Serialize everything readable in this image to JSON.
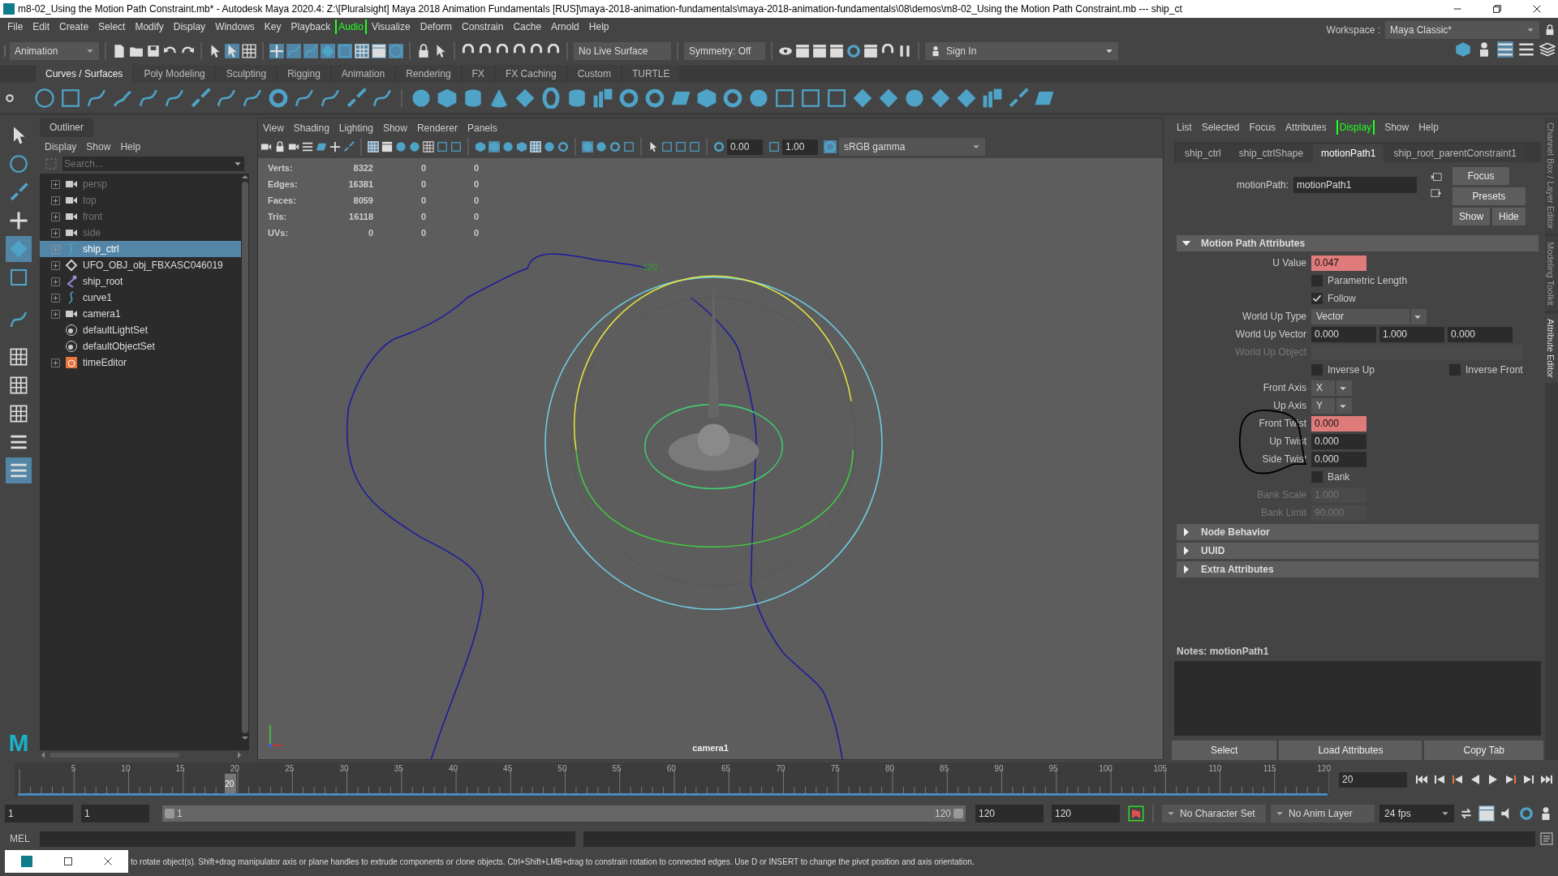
{
  "window": {
    "title": "m8-02_Using the Motion Path Constraint.mb* - Autodesk Maya 2020.4: Z:\\[Pluralsight] Maya 2018 Animation Fundamentals [RUS]\\maya-2018-animation-fundamentals\\maya-2018-animation-fundamentals\\08\\demos\\m8-02_Using the Motion Path Constraint.mb   ---   ship_ct"
  },
  "menu_bar": [
    {
      "label": "File",
      "bracketed": false
    },
    {
      "label": "Edit",
      "bracketed": false
    },
    {
      "label": "Create",
      "bracketed": false
    },
    {
      "label": "Select",
      "bracketed": false
    },
    {
      "label": "Modify",
      "bracketed": false
    },
    {
      "label": "Display",
      "bracketed": false
    },
    {
      "label": "Windows",
      "bracketed": false
    },
    {
      "label": "Key",
      "bracketed": false
    },
    {
      "label": "Playback",
      "bracketed": false
    },
    {
      "label": "Audio",
      "bracketed": true
    },
    {
      "label": "Visualize",
      "bracketed": false
    },
    {
      "label": "Deform",
      "bracketed": false
    },
    {
      "label": "Constrain",
      "bracketed": false
    },
    {
      "label": "Cache",
      "bracketed": false
    },
    {
      "label": "Arnold",
      "bracketed": false
    },
    {
      "label": "Help",
      "bracketed": false
    }
  ],
  "status_line": {
    "mode": "Animation",
    "live_surface": "No Live Surface",
    "symmetry": "Symmetry: Off",
    "sign_in": "Sign In",
    "workspace_label": "Workspace :",
    "workspace": "Maya Classic*"
  },
  "shelf_tabs": [
    {
      "label": "Curves / Surfaces",
      "selected": true
    },
    {
      "label": "Poly Modeling",
      "selected": false
    },
    {
      "label": "Sculpting",
      "selected": false
    },
    {
      "label": "Rigging",
      "selected": false
    },
    {
      "label": "Animation",
      "selected": false
    },
    {
      "label": "Rendering",
      "selected": false
    },
    {
      "label": "FX",
      "selected": false
    },
    {
      "label": "FX Caching",
      "selected": false
    },
    {
      "label": "Custom",
      "selected": false
    },
    {
      "label": "TURTLE",
      "selected": false
    }
  ],
  "toolbox": {
    "logo": "M"
  },
  "outliner": {
    "title": "Outliner",
    "menus": [
      "Display",
      "Show",
      "Help"
    ],
    "search_placeholder": "Search...",
    "items": [
      {
        "label": "persp",
        "kind": "camera",
        "expandable": true,
        "dimmed": true,
        "selected": false
      },
      {
        "label": "top",
        "kind": "camera",
        "expandable": true,
        "dimmed": true,
        "selected": false
      },
      {
        "label": "front",
        "kind": "camera",
        "expandable": true,
        "dimmed": true,
        "selected": false
      },
      {
        "label": "side",
        "kind": "camera",
        "expandable": true,
        "dimmed": true,
        "selected": false
      },
      {
        "label": "ship_ctrl",
        "kind": "curve",
        "expandable": true,
        "dimmed": false,
        "selected": true
      },
      {
        "label": "UFO_OBJ_obj_FBXASC046019",
        "kind": "mesh",
        "expandable": true,
        "dimmed": false,
        "selected": false
      },
      {
        "label": "ship_root",
        "kind": "joint",
        "expandable": true,
        "dimmed": false,
        "selected": false
      },
      {
        "label": "curve1",
        "kind": "curve",
        "expandable": true,
        "dimmed": false,
        "selected": false
      },
      {
        "label": "camera1",
        "kind": "camera",
        "expandable": true,
        "dimmed": false,
        "selected": false
      },
      {
        "label": "defaultLightSet",
        "kind": "set",
        "expandable": false,
        "dimmed": false,
        "selected": false
      },
      {
        "label": "defaultObjectSet",
        "kind": "set",
        "expandable": false,
        "dimmed": false,
        "selected": false
      },
      {
        "label": "timeEditor",
        "kind": "time",
        "expandable": true,
        "dimmed": false,
        "selected": false
      }
    ]
  },
  "viewport": {
    "menus": [
      "View",
      "Shading",
      "Lighting",
      "Show",
      "Renderer",
      "Panels"
    ],
    "exposure": "0.00",
    "gamma": "1.00",
    "color_space": "sRGB gamma",
    "stats": [
      {
        "label": "Verts:",
        "values": [
          "8322",
          "0",
          "0"
        ]
      },
      {
        "label": "Edges:",
        "values": [
          "16381",
          "0",
          "0"
        ]
      },
      {
        "label": "Faces:",
        "values": [
          "8059",
          "0",
          "0"
        ]
      },
      {
        "label": "Tris:",
        "values": [
          "16118",
          "0",
          "0"
        ]
      },
      {
        "label": "UVs:",
        "values": [
          "0",
          "0",
          "0"
        ]
      }
    ],
    "path_label": "120",
    "camera": "camera1"
  },
  "attribute_editor": {
    "menus": [
      {
        "label": "List",
        "bracketed": false
      },
      {
        "label": "Selected",
        "bracketed": false
      },
      {
        "label": "Focus",
        "bracketed": false
      },
      {
        "label": "Attributes",
        "bracketed": false
      },
      {
        "label": "Display",
        "bracketed": true
      },
      {
        "label": "Show",
        "bracketed": false
      },
      {
        "label": "Help",
        "bracketed": false
      }
    ],
    "tabs": [
      {
        "label": "ship_ctrl",
        "selected": false
      },
      {
        "label": "ship_ctrlShape",
        "selected": false
      },
      {
        "label": "motionPath1",
        "selected": true
      },
      {
        "label": "ship_root_parentConstraint1",
        "selected": false
      }
    ],
    "node_label": "motionPath:",
    "node_name": "motionPath1",
    "buttons": [
      "Focus",
      "Presets",
      "Show",
      "Hide"
    ],
    "sections": [
      {
        "title": "Motion Path Attributes",
        "expanded": true,
        "rows": [
          {
            "kind": "number",
            "label": "U Value",
            "values": [
              "0.047"
            ],
            "keyed": true,
            "disabled": false,
            "circled": false
          },
          {
            "kind": "checkbox",
            "label": "Parametric Length",
            "checked": false
          },
          {
            "kind": "checkbox",
            "label": "Follow",
            "checked": true
          },
          {
            "kind": "menu",
            "label": "World Up Type",
            "value": "Vector"
          },
          {
            "kind": "number",
            "label": "World Up Vector",
            "values": [
              "0.000",
              "1.000",
              "0.000"
            ],
            "keyed": false,
            "disabled": false,
            "circled": false
          },
          {
            "kind": "field",
            "label": "World Up Object",
            "disabled": true
          },
          {
            "kind": "checkbox_pair",
            "items": [
              {
                "label": "Inverse Up",
                "checked": false
              },
              {
                "label": "Inverse Front",
                "checked": false
              }
            ]
          },
          {
            "kind": "axis",
            "label": "Front Axis",
            "value": "X"
          },
          {
            "kind": "axis",
            "label": "Up Axis",
            "value": "Y"
          },
          {
            "kind": "number",
            "label": "Front Twist",
            "values": [
              "0.000"
            ],
            "keyed": true,
            "disabled": false,
            "circled": true
          },
          {
            "kind": "number",
            "label": "Up Twist",
            "values": [
              "0.000"
            ],
            "keyed": false,
            "disabled": false,
            "circled": true
          },
          {
            "kind": "number",
            "label": "Side Twist",
            "values": [
              "0.000"
            ],
            "keyed": false,
            "disabled": false,
            "circled": true
          },
          {
            "kind": "checkbox",
            "label": "Bank",
            "checked": false
          },
          {
            "kind": "number",
            "label": "Bank Scale",
            "values": [
              "1.000"
            ],
            "keyed": false,
            "disabled": true,
            "circled": false
          },
          {
            "kind": "number",
            "label": "Bank Limit",
            "values": [
              "90.000"
            ],
            "keyed": false,
            "disabled": true,
            "circled": false
          }
        ]
      },
      {
        "title": "Node Behavior",
        "expanded": false
      },
      {
        "title": "UUID",
        "expanded": false
      },
      {
        "title": "Extra Attributes",
        "expanded": false
      }
    ],
    "notes_label": "Notes:  motionPath1",
    "bottom_buttons": [
      "Select",
      "Load Attributes",
      "Copy Tab"
    ]
  },
  "side_tabs": [
    {
      "label": "Channel Box / Layer Editor",
      "selected": false
    },
    {
      "label": "Modeling Toolkit",
      "selected": false
    },
    {
      "label": "Attribute Editor",
      "selected": true
    }
  ],
  "time_slider": {
    "ticks": [
      "5",
      "10",
      "15",
      "20",
      "25",
      "30",
      "35",
      "40",
      "45",
      "50",
      "55",
      "60",
      "65",
      "70",
      "75",
      "80",
      "85",
      "90",
      "95",
      "100",
      "105",
      "110",
      "115",
      "120"
    ],
    "playhead": {
      "label": "20",
      "level": 0.16
    },
    "current_frame": "20"
  },
  "range_slider": {
    "start": "1",
    "playback_start": "1",
    "bar_start": "1",
    "bar_end": "120",
    "playback_end": "120",
    "end": "120",
    "character_set": "No Character Set",
    "anim_layer": "No Anim Layer",
    "fps": "24 fps"
  },
  "command_line": {
    "language": "MEL"
  },
  "help_line": "to rotate object(s). Shift+drag manipulator axis or plane handles to extrude components or clone objects. Ctrl+Shift+LMB+drag to constrain rotation to connected edges. Use D or INSERT to change the pivot position and axis orientation."
}
